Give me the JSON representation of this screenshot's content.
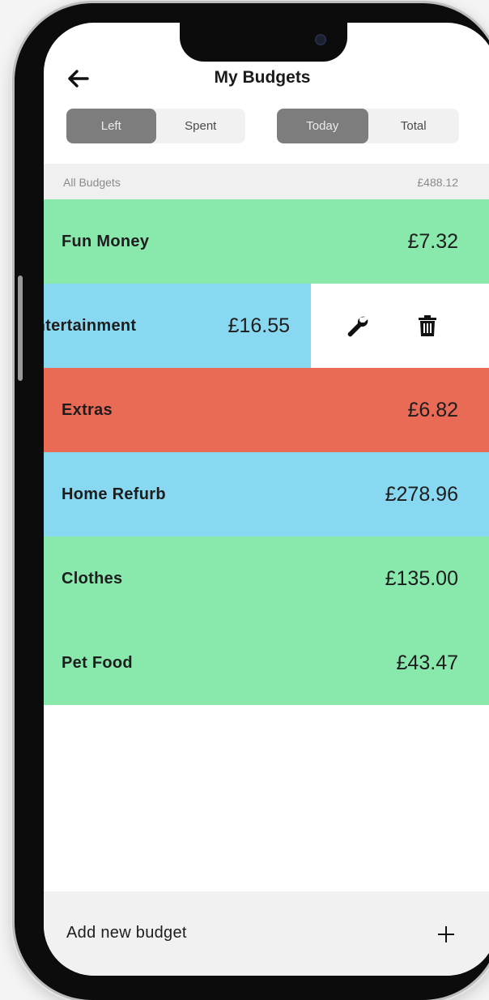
{
  "header": {
    "title": "My Budgets",
    "toggle_mode": {
      "options": [
        "Left",
        "Spent"
      ],
      "selected": "Left"
    },
    "toggle_range": {
      "options": [
        "Today",
        "Total"
      ],
      "selected": "Today"
    }
  },
  "summary": {
    "label": "All Budgets",
    "value": "£488.12"
  },
  "budgets": [
    {
      "name": "Fun Money",
      "amount": "£7.32",
      "color": "#89e9ad"
    },
    {
      "name": "Entertainment",
      "amount": "£16.55",
      "color": "#87d8f0",
      "swiped": true
    },
    {
      "name": "Extras",
      "amount": "£6.82",
      "color": "#e96a55"
    },
    {
      "name": "Home Refurb",
      "amount": "£278.96",
      "color": "#87d8f0"
    },
    {
      "name": "Clothes",
      "amount": "£135.00",
      "color": "#89e9ad"
    },
    {
      "name": "Pet Food",
      "amount": "£43.47",
      "color": "#89e9ad"
    }
  ],
  "swipe_actions": {
    "edit_icon": "wrench-icon",
    "delete_icon": "trash-icon"
  },
  "footer": {
    "add_label": "Add new budget",
    "add_icon": "plus-icon"
  },
  "icons": {
    "back": "arrow-left-icon"
  }
}
